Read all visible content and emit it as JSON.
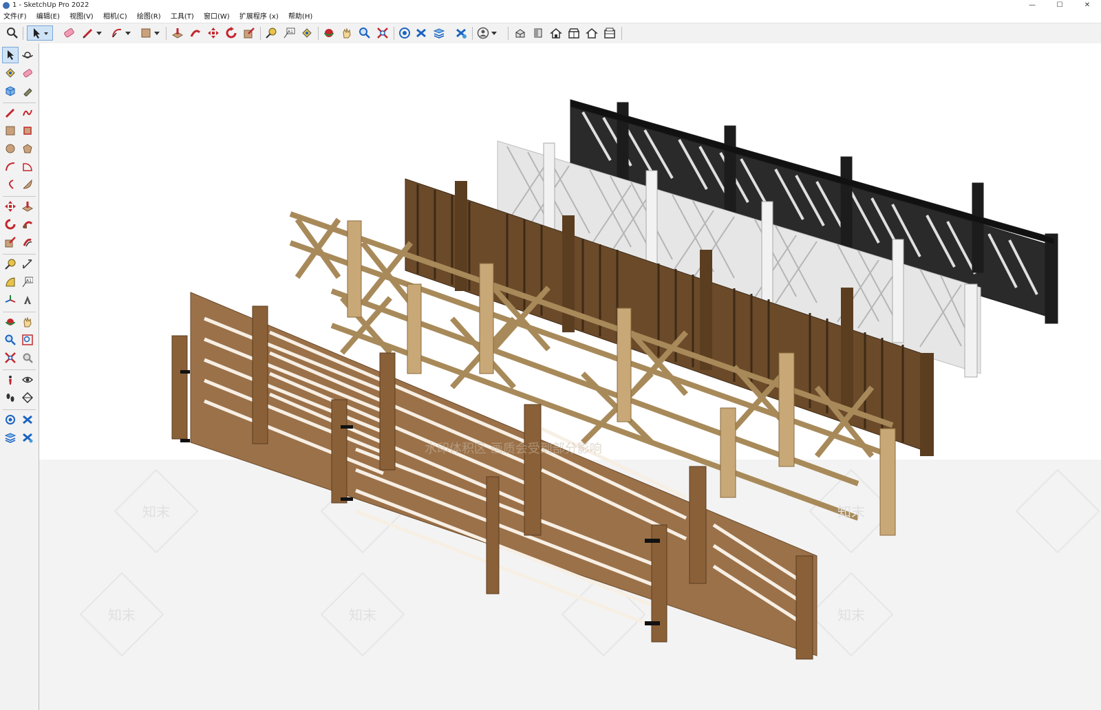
{
  "window": {
    "title": "1 - SketchUp Pro 2022"
  },
  "menu": {
    "items": [
      "文件(F)",
      "编辑(E)",
      "视图(V)",
      "相机(C)",
      "绘图(R)",
      "工具(T)",
      "窗口(W)",
      "扩展程序 (x)",
      "帮助(H)"
    ]
  },
  "toolbar": {
    "icons": [
      "zoom-icon",
      "select-icon",
      "eraser-icon",
      "pencil-icon",
      "arc-icon",
      "rectangle-icon",
      "push-pull-icon",
      "follow-me-icon",
      "move-icon",
      "rotate-icon",
      "scale-icon",
      "tape-measure-icon",
      "text-icon",
      "paint-bucket-icon",
      "orbit-icon",
      "pan-icon",
      "zoom-tool-icon",
      "zoom-extents-icon",
      "3d-warehouse-icon",
      "extension-warehouse-icon",
      "layout-icon",
      "extension-manager-icon",
      "account-icon",
      "iso-view-icon",
      "top-view-icon",
      "front-view-icon",
      "right-view-icon",
      "back-view-icon",
      "left-view-icon"
    ]
  },
  "left_toolbar": {
    "icons": [
      "select-icon",
      "orbit-icon",
      "paint-icon",
      "eraser-icon",
      "components-icon",
      "pencil-tag-icon",
      "line-icon",
      "freehand-icon",
      "rectangle-icon",
      "rotated-rectangle-icon",
      "circle-icon",
      "polygon-icon",
      "arc-icon",
      "pie-icon",
      "two-point-arc-icon",
      "three-point-arc-icon",
      "move-icon",
      "push-pull-icon",
      "rotate-icon",
      "follow-me-icon",
      "scale-icon",
      "offset-icon",
      "tape-measure-icon",
      "dimension-icon",
      "protractor-icon",
      "text-icon",
      "axes-icon",
      "3d-text-icon",
      "orbit-tool-icon",
      "pan-icon",
      "zoom-icon",
      "zoom-window-icon",
      "zoom-extents-icon",
      "previous-view-icon",
      "position-camera-icon",
      "look-around-icon",
      "walk-icon",
      "section-plane-icon",
      "3d-warehouse-icon",
      "extension-warehouse-icon",
      "layout-icon",
      "extension-manager-icon"
    ]
  },
  "viewport": {
    "watermark_text": "水印体积区  画质会受到部分影响",
    "watermark_logo": "知末",
    "fence_colors": {
      "black": "#1c1c1c",
      "white": "#e4e4e4",
      "dark_brown": "#5b3d20",
      "light_wood": "#c9a878",
      "medium_wood": "#9b7149"
    }
  }
}
